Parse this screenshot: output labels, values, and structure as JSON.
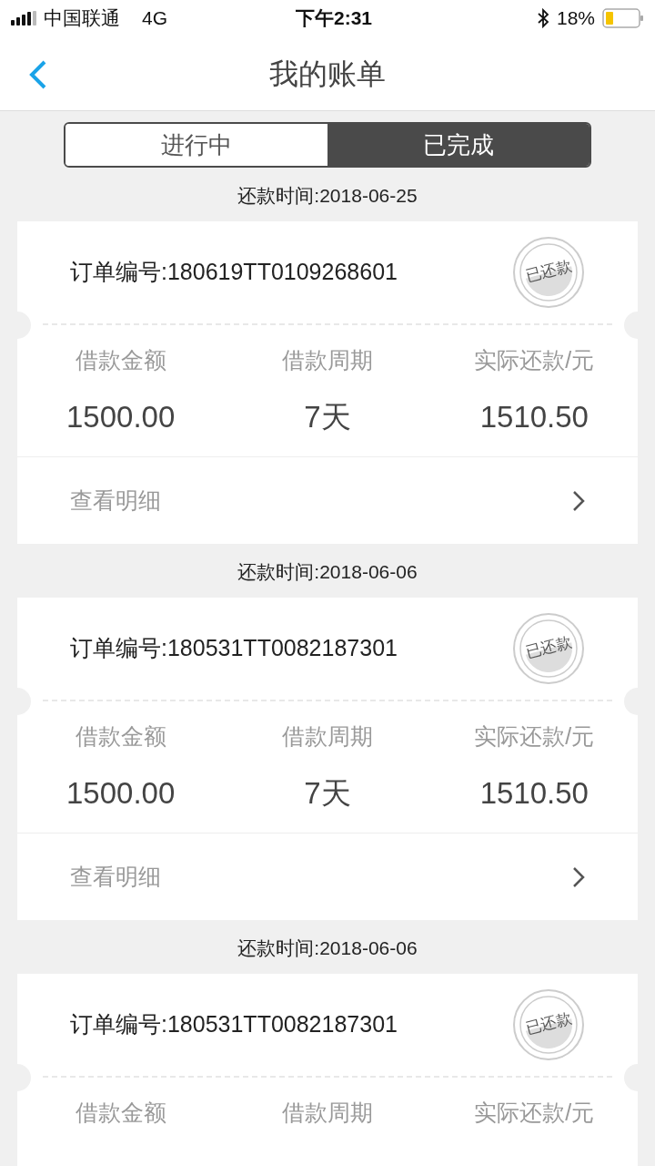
{
  "status_bar": {
    "carrier": "中国联通",
    "network": "4G",
    "time": "下午2:31",
    "battery": "18%"
  },
  "nav": {
    "title": "我的账单"
  },
  "tabs": [
    {
      "label": "进行中",
      "selected": false
    },
    {
      "label": "已完成",
      "selected": true
    }
  ],
  "bills": [
    {
      "date": "还款时间:2018-06-25",
      "order": "订单编号:180619TT0109268601",
      "stamp": "已还款",
      "stats": [
        {
          "label": "借款金额",
          "value": "1500.00"
        },
        {
          "label": "借款周期",
          "value": "7天"
        },
        {
          "label": "实际还款/元",
          "value": "1510.50"
        }
      ],
      "detail": "查看明细"
    },
    {
      "date": "还款时间:2018-06-06",
      "order": "订单编号:180531TT0082187301",
      "stamp": "已还款",
      "stats": [
        {
          "label": "借款金额",
          "value": "1500.00"
        },
        {
          "label": "借款周期",
          "value": "7天"
        },
        {
          "label": "实际还款/元",
          "value": "1510.50"
        }
      ],
      "detail": "查看明细"
    },
    {
      "date": "还款时间:2018-06-06",
      "order": "订单编号:180531TT0082187301",
      "stamp": "已还款",
      "stats": [
        {
          "label": "借款金额"
        },
        {
          "label": "借款周期"
        },
        {
          "label": "实际还款/元"
        }
      ]
    }
  ]
}
